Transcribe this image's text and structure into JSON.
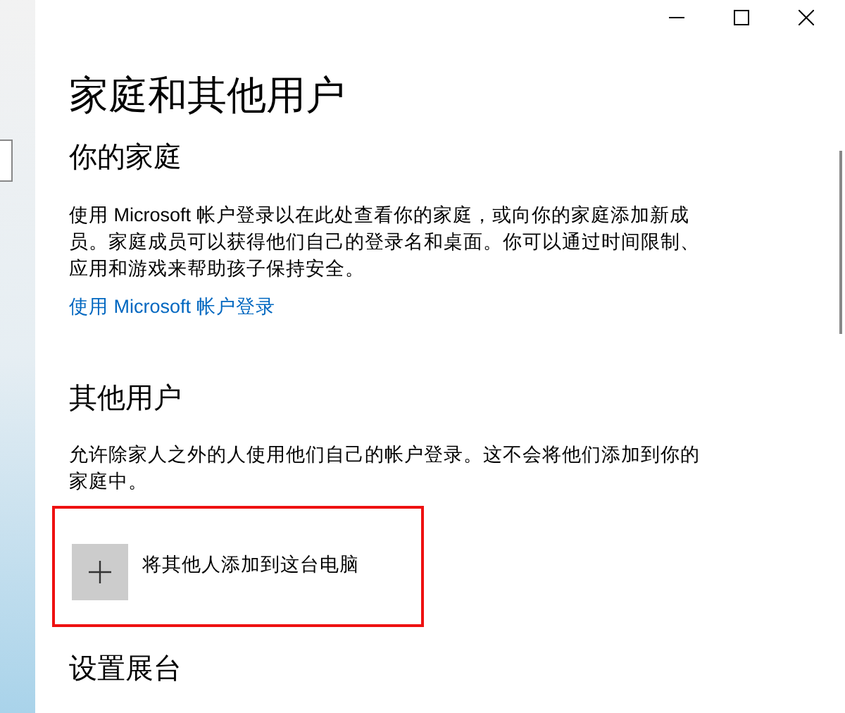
{
  "window_controls": [
    {
      "kind": "minimize"
    },
    {
      "kind": "maximize"
    },
    {
      "kind": "close"
    }
  ],
  "title": "家庭和其他用户",
  "family_section": {
    "heading": "你的家庭",
    "description": "使用 Microsoft 帐户登录以在此处查看你的家庭，或向你的家庭添加新成员。家庭成员可以获得他们自己的登录名和桌面。你可以通过时间限制、应用和游戏来帮助孩子保持安全。",
    "link": "使用 Microsoft 帐户登录"
  },
  "other_users_section": {
    "heading": "其他用户",
    "description": "允许除家人之外的人使用他们自己的帐户登录。这不会将他们添加到你的家庭中。",
    "add_button": {
      "label": "将其他人添加到这台电脑",
      "highlighted": true
    }
  },
  "kiosk_section": {
    "heading": "设置展台"
  }
}
